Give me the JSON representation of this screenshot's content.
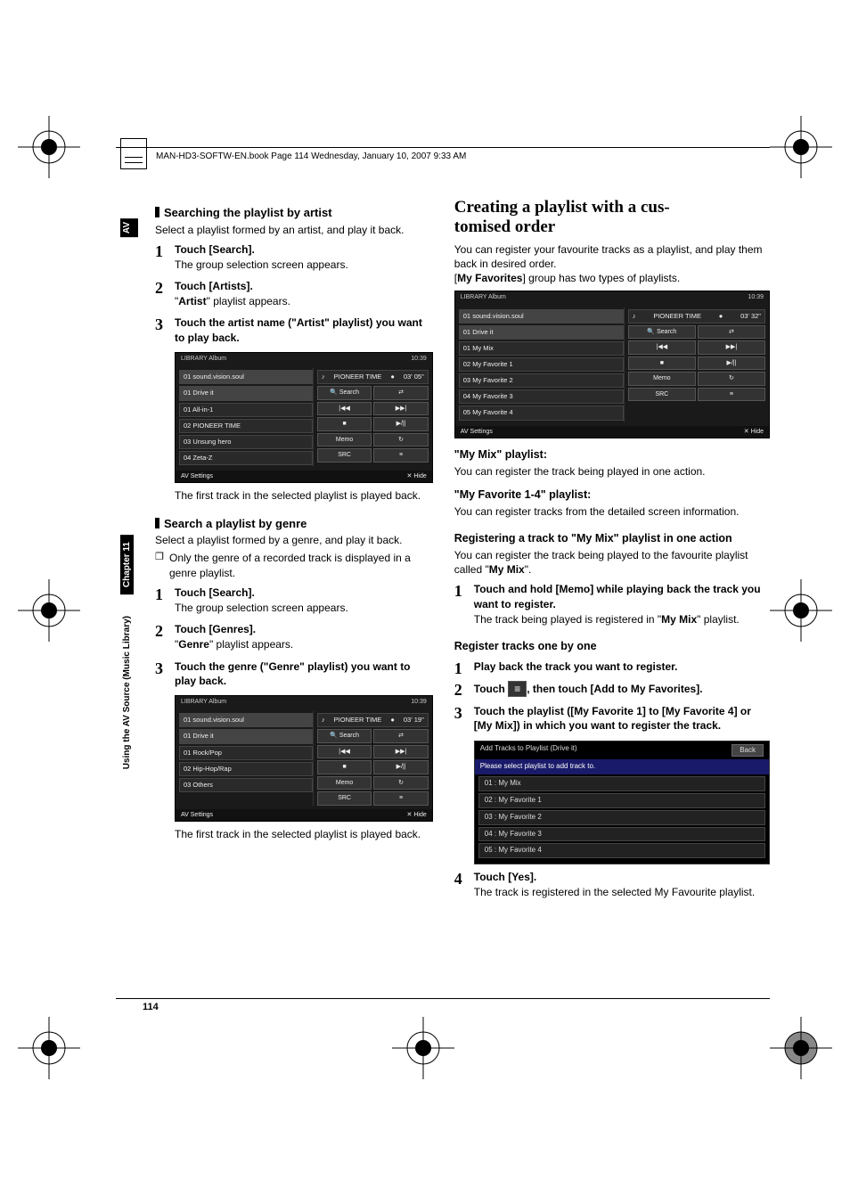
{
  "book_header": "MAN-HD3-SOFTW-EN.book  Page 114  Wednesday, January 10, 2007  9:33 AM",
  "page_number": "114",
  "side": {
    "av": "AV",
    "chapter": "Chapter 11",
    "section": "Using the AV Source (Music Library)"
  },
  "left": {
    "h1": "Searching the playlist by artist",
    "p1": "Select a playlist formed by an artist, and play it back.",
    "steps1": [
      {
        "head": "Touch [Search].",
        "body": "The group selection screen appears."
      },
      {
        "head": "Touch [Artists].",
        "body_pre": "\"",
        "body_bold": "Artist",
        "body_post": "\" playlist appears."
      },
      {
        "head": "Touch the artist name (\"Artist\" playlist) you want to play back."
      }
    ],
    "shot1": {
      "library": "LIBRARY  Album",
      "time": "10:39",
      "now1": "01  sound.vision.soul",
      "now2": "01  Drive it",
      "pioneer": "PIONEER TIME",
      "dur": "03' 05\"",
      "rows": [
        "01 All-in-1",
        "02 PIONEER TIME",
        "03 Unsung hero",
        "04 Zeta-Z"
      ],
      "btns": [
        "Search",
        "Memo"
      ],
      "foot_left": "AV Settings",
      "foot_right": "Hide"
    },
    "after1": "The first track in the selected playlist is played back.",
    "h2": "Search a playlist by genre",
    "p2": "Select a playlist formed by a genre, and play it back.",
    "note1": "Only the genre of a recorded track is displayed in a genre playlist.",
    "steps2": [
      {
        "head": "Touch [Search].",
        "body": "The group selection screen appears."
      },
      {
        "head": "Touch [Genres].",
        "body_pre": "\"",
        "body_bold": "Genre",
        "body_post": "\" playlist appears."
      },
      {
        "head": "Touch the genre (\"Genre\" playlist) you want to play back."
      }
    ],
    "shot2": {
      "library": "LIBRARY  Album",
      "time": "10:39",
      "now1": "01  sound.vision.soul",
      "now2": "01  Drive it",
      "pioneer": "PIONEER TIME",
      "dur": "03' 19\"",
      "rows": [
        "01 Rock/Pop",
        "02 Hip-Hop/Rap",
        "03 Others"
      ],
      "btns": [
        "Search",
        "Memo"
      ],
      "foot_left": "AV Settings",
      "foot_right": "Hide"
    },
    "after2": "The first track in the selected playlist is played back."
  },
  "right": {
    "h1a": "Creating a playlist with a cus-",
    "h1b": "tomised order",
    "p1": "You can register your favourite tracks as a playlist, and play them back in desired order.",
    "p2_pre": "[",
    "p2_bold": "My Favorites",
    "p2_post": "] group has two types of playlists.",
    "shot1": {
      "library": "LIBRARY  Album",
      "time": "10:39",
      "now1": "01  sound.vision.soul",
      "now2": "01  Drive it",
      "pioneer": "PIONEER TIME",
      "dur": "03' 32\"",
      "rows": [
        "01 My Mix",
        "02 My Favorite 1",
        "03 My Favorite 2",
        "04 My Favorite 3",
        "05 My Favorite 4"
      ],
      "btns": [
        "Search",
        "Memo"
      ],
      "foot_left": "AV Settings",
      "foot_right": "Hide"
    },
    "h_mymix": "\"My Mix\" playlist:",
    "p_mymix": "You can register the track being played in one action.",
    "h_myfav": "\"My Favorite 1-4\" playlist:",
    "p_myfav": "You can register tracks from the detailed screen information.",
    "h_reg": "Registering a track to \"My Mix\" playlist in one action",
    "p_reg_pre": "You can register the track being played to the favourite playlist called \"",
    "p_reg_bold": "My Mix",
    "p_reg_post": "\".",
    "steps1": [
      {
        "head": "Touch and hold [Memo] while playing back the track you want to register.",
        "body_pre": "The track being played is registered in \"",
        "body_bold": "My Mix",
        "body_post": "\" playlist."
      }
    ],
    "h_one": "Register tracks one by one",
    "steps2": [
      {
        "head": "Play back the track you want to register."
      },
      {
        "head_pre": "Touch ",
        "head_post": ", then touch [Add to My Favorites]."
      },
      {
        "head": "Touch the playlist ([My Favorite 1] to [My Favorite 4] or [My Mix]) in which you want to register the track."
      }
    ],
    "shot_add": {
      "title": "Add Tracks to Playlist (Drive it)",
      "back": "Back",
      "sub": "Please select playlist to add track to.",
      "rows": [
        "01 : My Mix",
        "02 : My Favorite 1",
        "03 : My Favorite 2",
        "04 : My Favorite 3",
        "05 : My Favorite 4"
      ]
    },
    "steps3": [
      {
        "head": "Touch [Yes].",
        "body": "The track is registered in the selected My Favourite playlist."
      }
    ]
  }
}
